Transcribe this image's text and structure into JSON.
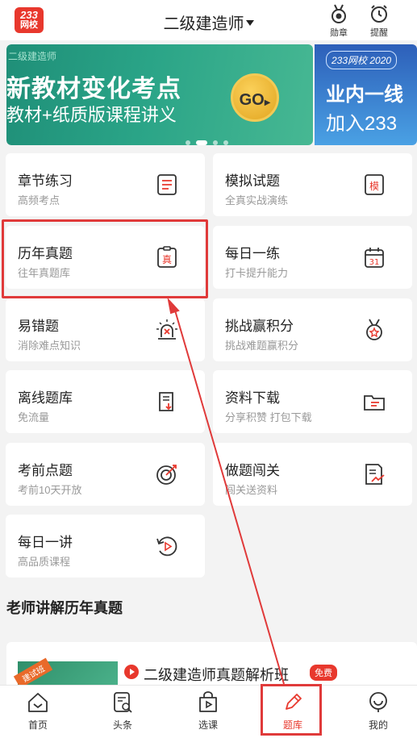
{
  "header": {
    "logo_top": "233",
    "logo_bottom": "网校",
    "title": "二级建造师",
    "medal_label": "勋章",
    "remind_label": "提醒"
  },
  "banner": {
    "tag": "二级建造师",
    "headline": "新教材变化考点",
    "subline": "教材+纸质版课程讲义",
    "go_label": "GO",
    "right_logo": "233网校 2020",
    "right_line1": "业内一线",
    "right_line2": "加入233",
    "active_dot": 1,
    "dot_count": 4
  },
  "cards": [
    {
      "title": "章节练习",
      "sub": "高频考点",
      "icon": "list-doc-icon"
    },
    {
      "title": "模拟试题",
      "sub": "全真实战演练",
      "icon": "mock-exam-icon",
      "icon_text": "模"
    },
    {
      "title": "历年真题",
      "sub": "往年真题库",
      "icon": "clipboard-icon",
      "icon_text": "真"
    },
    {
      "title": "每日一练",
      "sub": "打卡提升能力",
      "icon": "calendar-icon",
      "icon_text": "31"
    },
    {
      "title": "易错题",
      "sub": "消除难点知识",
      "icon": "alarm-icon"
    },
    {
      "title": "挑战赢积分",
      "sub": "挑战难题赢积分",
      "icon": "medal-star-icon"
    },
    {
      "title": "离线题库",
      "sub": "免流量",
      "icon": "download-doc-icon"
    },
    {
      "title": "资料下载",
      "sub": "分享积赞 打包下载",
      "icon": "folder-icon"
    },
    {
      "title": "考前点题",
      "sub": "考前10天开放",
      "icon": "target-icon"
    },
    {
      "title": "做题闯关",
      "sub": "闯关送资料",
      "icon": "chart-doc-icon"
    },
    {
      "title": "每日一讲",
      "sub": "高品质课程",
      "icon": "replay-icon"
    }
  ],
  "section_title": "老师讲解历年真题",
  "course": {
    "thumb_label": "建试班",
    "title": "二级建造师真题解析班",
    "badge": "免费"
  },
  "nav": [
    {
      "label": "首页",
      "icon": "home-icon"
    },
    {
      "label": "头条",
      "icon": "news-icon"
    },
    {
      "label": "选课",
      "icon": "course-bag-icon"
    },
    {
      "label": "题库",
      "icon": "pencil-icon",
      "active": true
    },
    {
      "label": "我的",
      "icon": "profile-icon"
    }
  ],
  "colors": {
    "accent": "#e8382d",
    "highlight": "#e03a3a",
    "banner_green": "#2aa487"
  }
}
